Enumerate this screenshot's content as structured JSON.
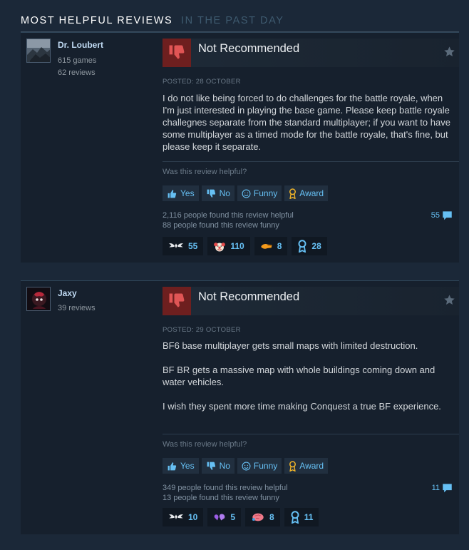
{
  "header": {
    "title": "MOST HELPFUL REVIEWS",
    "subtitle": "IN THE PAST DAY"
  },
  "reviews": [
    {
      "user": {
        "name": "Dr. Loubert",
        "games": "615 games",
        "reviews": "62 reviews"
      },
      "verdict": "Not Recommended",
      "posted": "POSTED: 28 OCTOBER",
      "paragraphs": [
        "I do not like being forced to do challenges for the battle royale, when I'm just interested in playing the base game. Please keep battle royale challegnes separate from the standard multiplayer; if you want to have some multiplayer as a timed mode for the battle royale, that's fine, but please keep it separate."
      ],
      "helpful_question": "Was this review helpful?",
      "buttons": {
        "yes": "Yes",
        "no": "No",
        "funny": "Funny",
        "award": "Award"
      },
      "helpful_count": "2,116 people found this review helpful",
      "funny_count": "88 people found this review funny",
      "comment_count": "55",
      "awards": [
        "55",
        "110",
        "8",
        "28"
      ]
    },
    {
      "user": {
        "name": "Jaxy",
        "reviews": "39 reviews"
      },
      "verdict": "Not Recommended",
      "posted": "POSTED: 29 OCTOBER",
      "paragraphs": [
        "BF6 base multiplayer gets small maps with limited destruction.",
        "BF BR gets a massive map with whole buildings coming down and water vehicles.",
        "I wish they spent more time making Conquest a true BF experience."
      ],
      "helpful_question": "Was this review helpful?",
      "buttons": {
        "yes": "Yes",
        "no": "No",
        "funny": "Funny",
        "award": "Award"
      },
      "helpful_count": "349 people found this review helpful",
      "funny_count": "13 people found this review funny",
      "comment_count": "11",
      "awards": [
        "10",
        "5",
        "8",
        "11"
      ]
    }
  ]
}
